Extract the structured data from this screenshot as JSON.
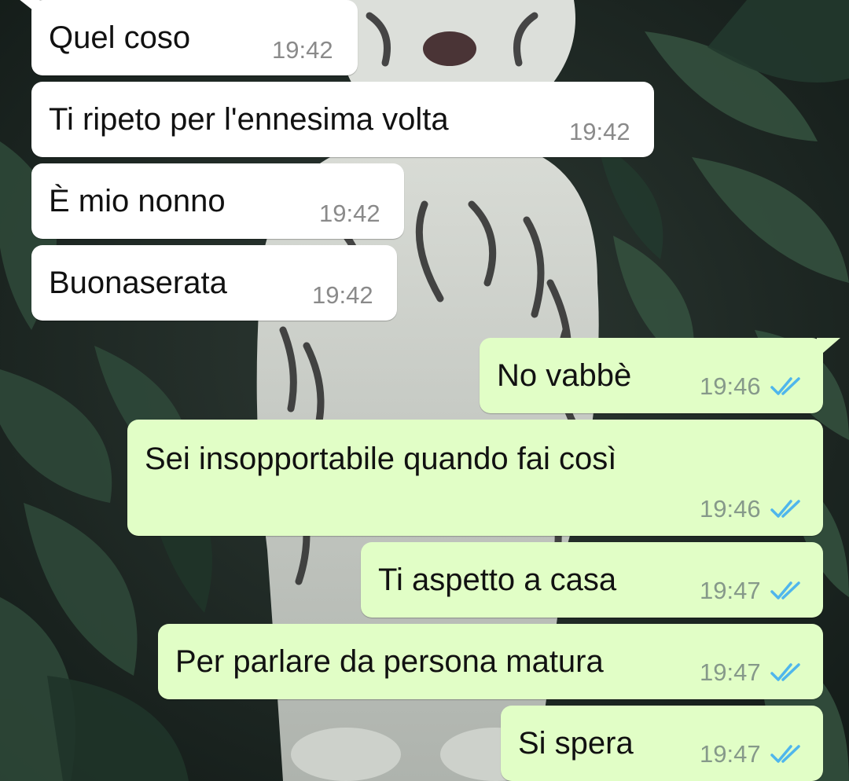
{
  "chat": {
    "messages": [
      {
        "direction": "incoming",
        "text": "Quel coso",
        "time": "19:42"
      },
      {
        "direction": "incoming",
        "text": "Ti ripeto per l'ennesima volta",
        "time": "19:42"
      },
      {
        "direction": "incoming",
        "text": "È mio nonno",
        "time": "19:42"
      },
      {
        "direction": "incoming",
        "text": "Buonaserata",
        "time": "19:42"
      },
      {
        "direction": "outgoing",
        "text": "No vabbè",
        "time": "19:46",
        "status": "read"
      },
      {
        "direction": "outgoing",
        "text": "Sei insopportabile quando fai così",
        "time": "19:46",
        "status": "read"
      },
      {
        "direction": "outgoing",
        "text": "Ti aspetto a casa",
        "time": "19:47",
        "status": "read"
      },
      {
        "direction": "outgoing",
        "text": "Per parlare da persona matura",
        "time": "19:47",
        "status": "read"
      },
      {
        "direction": "outgoing",
        "text": "Si spera",
        "time": "19:47",
        "status": "read"
      }
    ]
  },
  "colors": {
    "incoming_bubble": "#ffffff",
    "outgoing_bubble": "#e1fec6",
    "read_tick": "#4fb6ec",
    "timestamp": "#8a8a8a"
  },
  "icons": {
    "read_receipt": "double-check-icon",
    "wallpaper": "white-tiger-jungle-wallpaper"
  }
}
